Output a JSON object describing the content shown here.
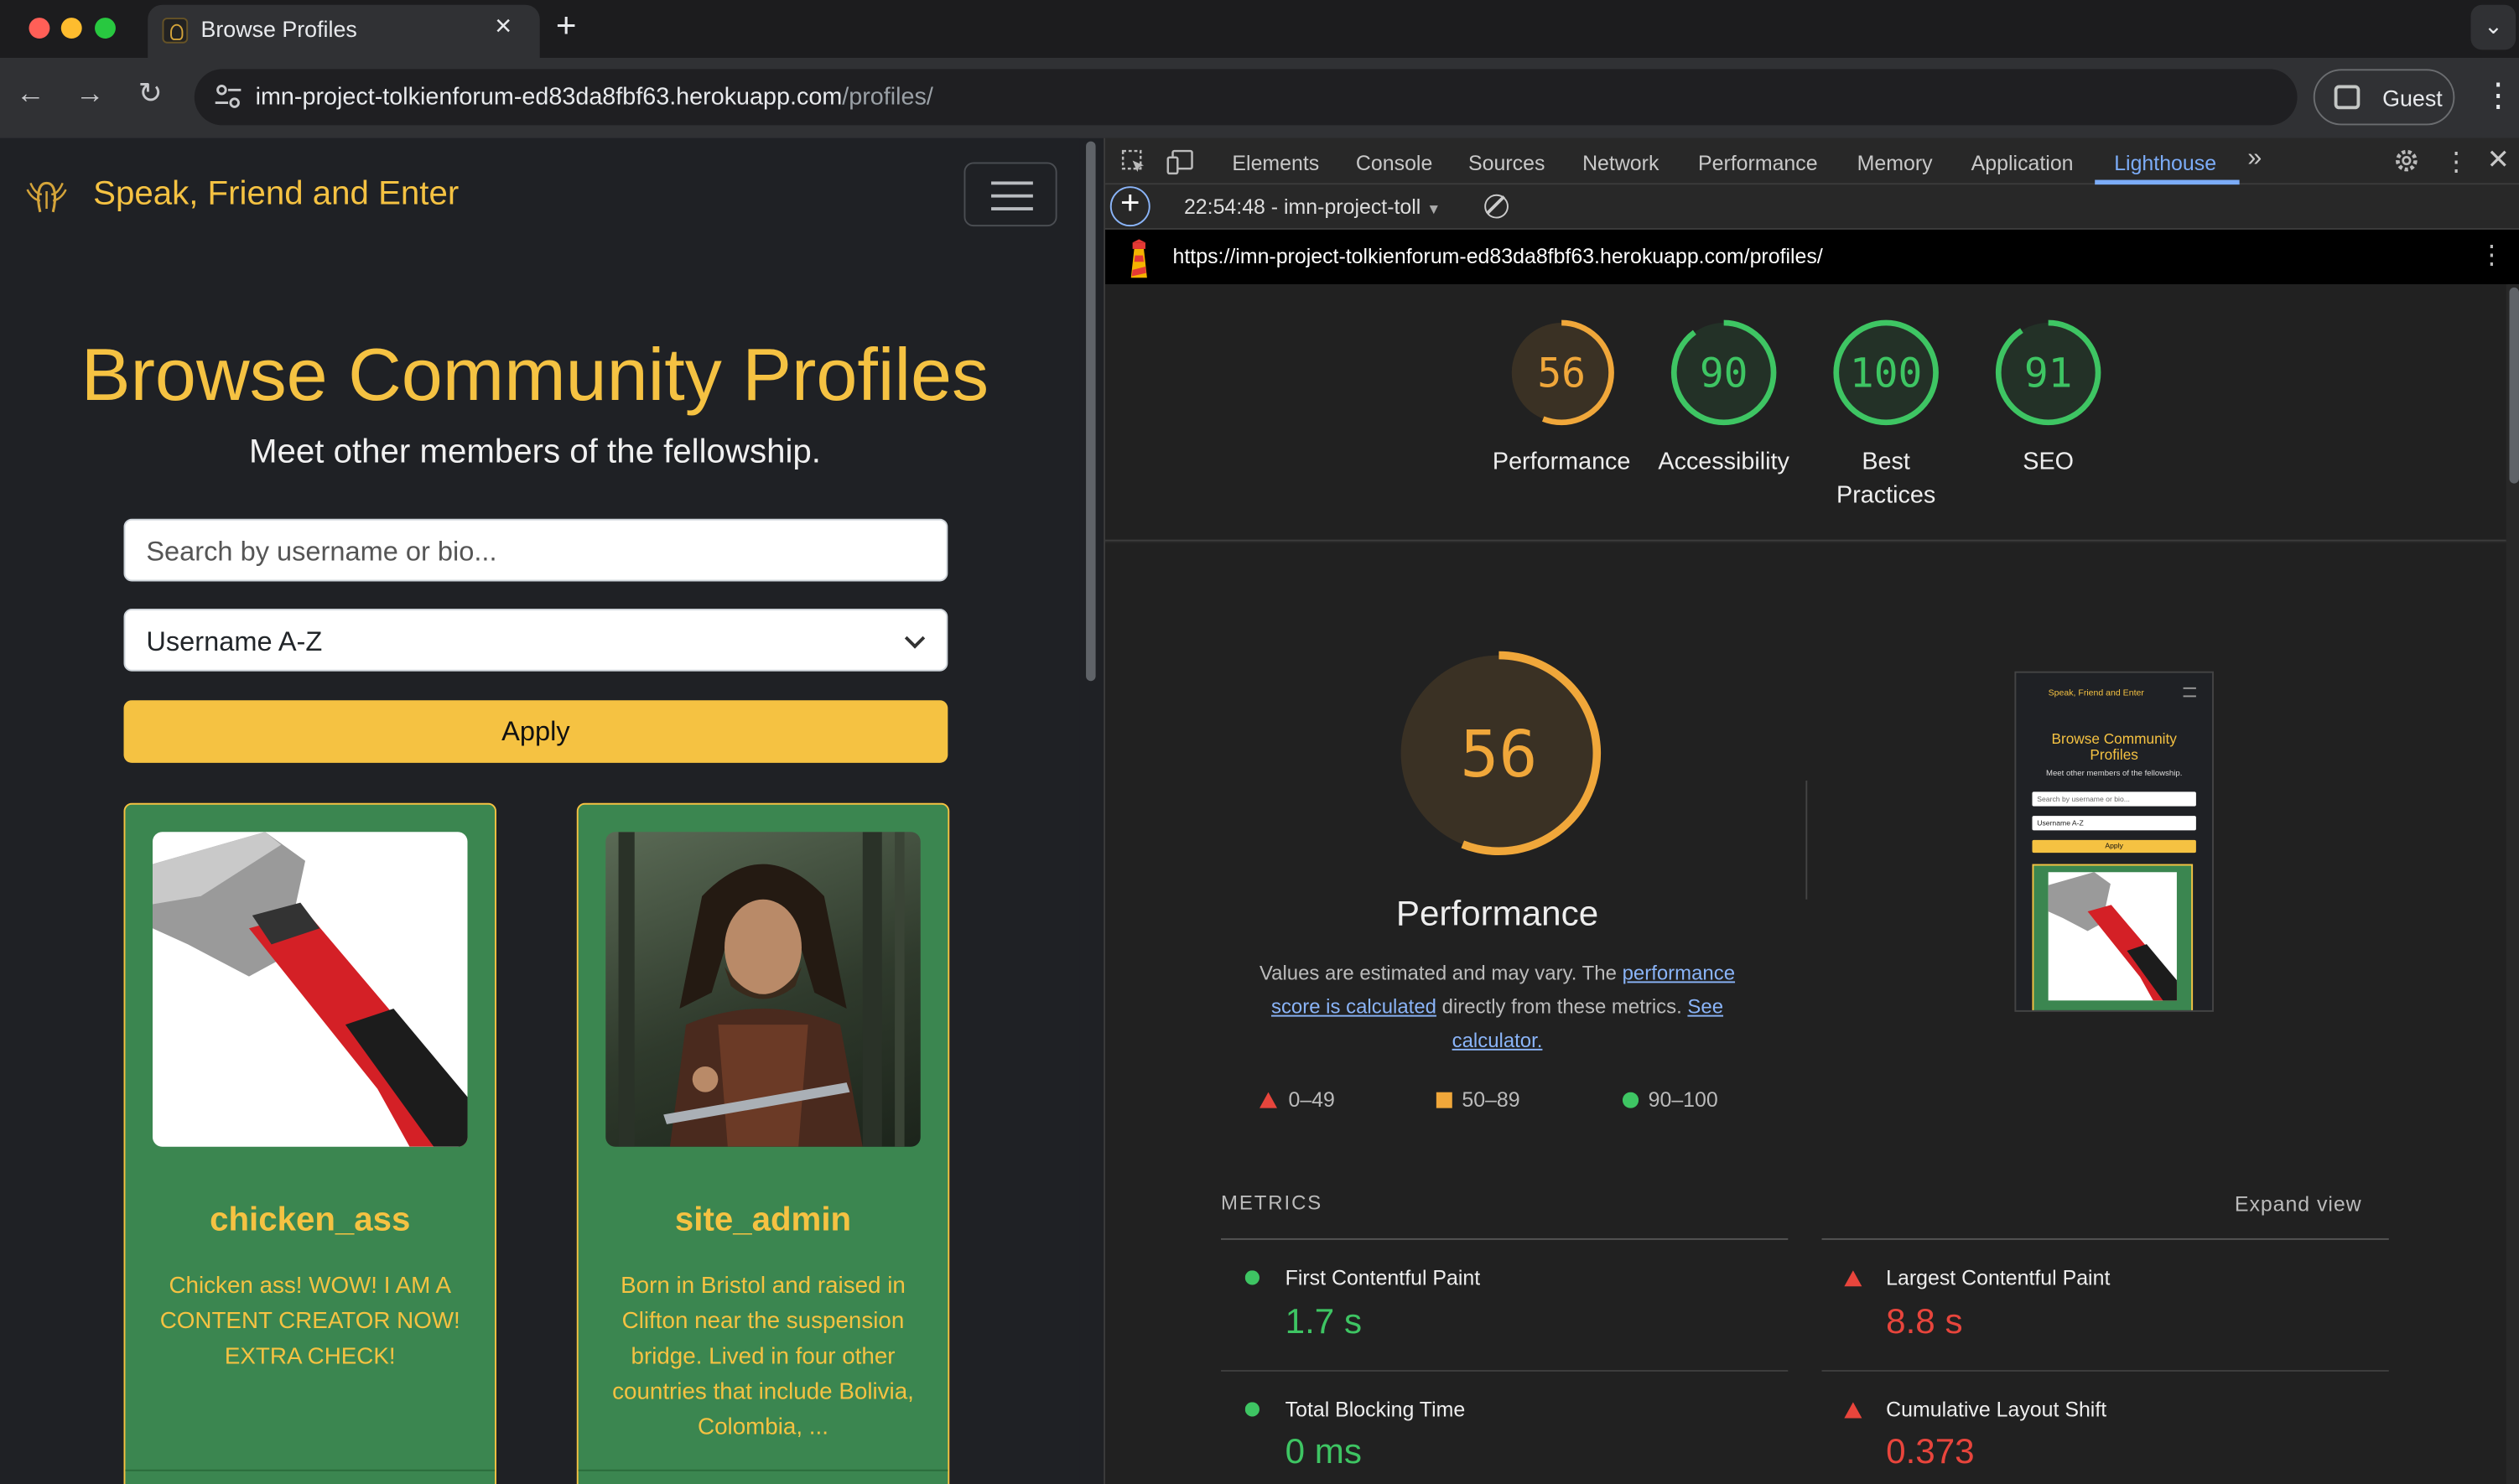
{
  "browser": {
    "tab_title": "Browse Profiles",
    "url_host": "imn-project-tolkienforum-ed83da8fbf63.herokuapp.com",
    "url_path": "/profiles/",
    "profile_label": "Guest"
  },
  "site": {
    "brand": "Speak, Friend and Enter",
    "heading": "Browse Community Profiles",
    "subheading": "Meet other members of the fellowship.",
    "search_placeholder": "Search by username or bio...",
    "sort_value": "Username A-Z",
    "apply_label": "Apply",
    "profiles": [
      {
        "username": "chicken_ass",
        "bio": "Chicken ass! WOW! I AM A CONTENT CREATOR NOW! EXTRA CHECK!"
      },
      {
        "username": "site_admin",
        "bio": "Born in Bristol and raised in Clifton near the suspension bridge. Lived in four other countries that include Bolivia, Colombia, ..."
      }
    ]
  },
  "devtools": {
    "tabs": [
      "Elements",
      "Console",
      "Sources",
      "Network",
      "Performance",
      "Memory",
      "Application",
      "Lighthouse"
    ],
    "active_tab": "Lighthouse",
    "run_label": "22:54:48 - imn-project-toll",
    "report_url": "https://imn-project-tolkienforum-ed83da8fbf63.herokuapp.com/profiles/",
    "scores": [
      {
        "label": "Performance",
        "value": 56,
        "color": "#f0a73a"
      },
      {
        "label": "Accessibility",
        "value": 90,
        "color": "#3ec563"
      },
      {
        "label": "Best Practices",
        "value": 100,
        "color": "#3ec563"
      },
      {
        "label": "SEO",
        "value": 91,
        "color": "#3ec563"
      }
    ],
    "performance_title": "Performance",
    "description_pre": "Values are estimated and may vary. The",
    "description_link1": "performance score is calculated",
    "description_mid": "directly from these metrics.",
    "description_link2": "See calculator.",
    "legend": [
      "0–49",
      "50–89",
      "90–100"
    ],
    "thumbnail": {
      "brand": "Speak, Friend and Enter",
      "heading": "Browse Community Profiles",
      "subheading": "Meet other members of the fellowship.",
      "search": "Search by username or bio...",
      "sort": "Username A-Z",
      "apply": "Apply"
    },
    "metrics_heading": "METRICS",
    "expand_label": "Expand view",
    "metrics": [
      {
        "name": "First Contentful Paint",
        "value": "1.7 s",
        "status": "pass"
      },
      {
        "name": "Largest Contentful Paint",
        "value": "8.8 s",
        "status": "fail"
      },
      {
        "name": "Total Blocking Time",
        "value": "0 ms",
        "status": "pass"
      },
      {
        "name": "Cumulative Layout Shift",
        "value": "0.373",
        "status": "fail"
      }
    ]
  }
}
